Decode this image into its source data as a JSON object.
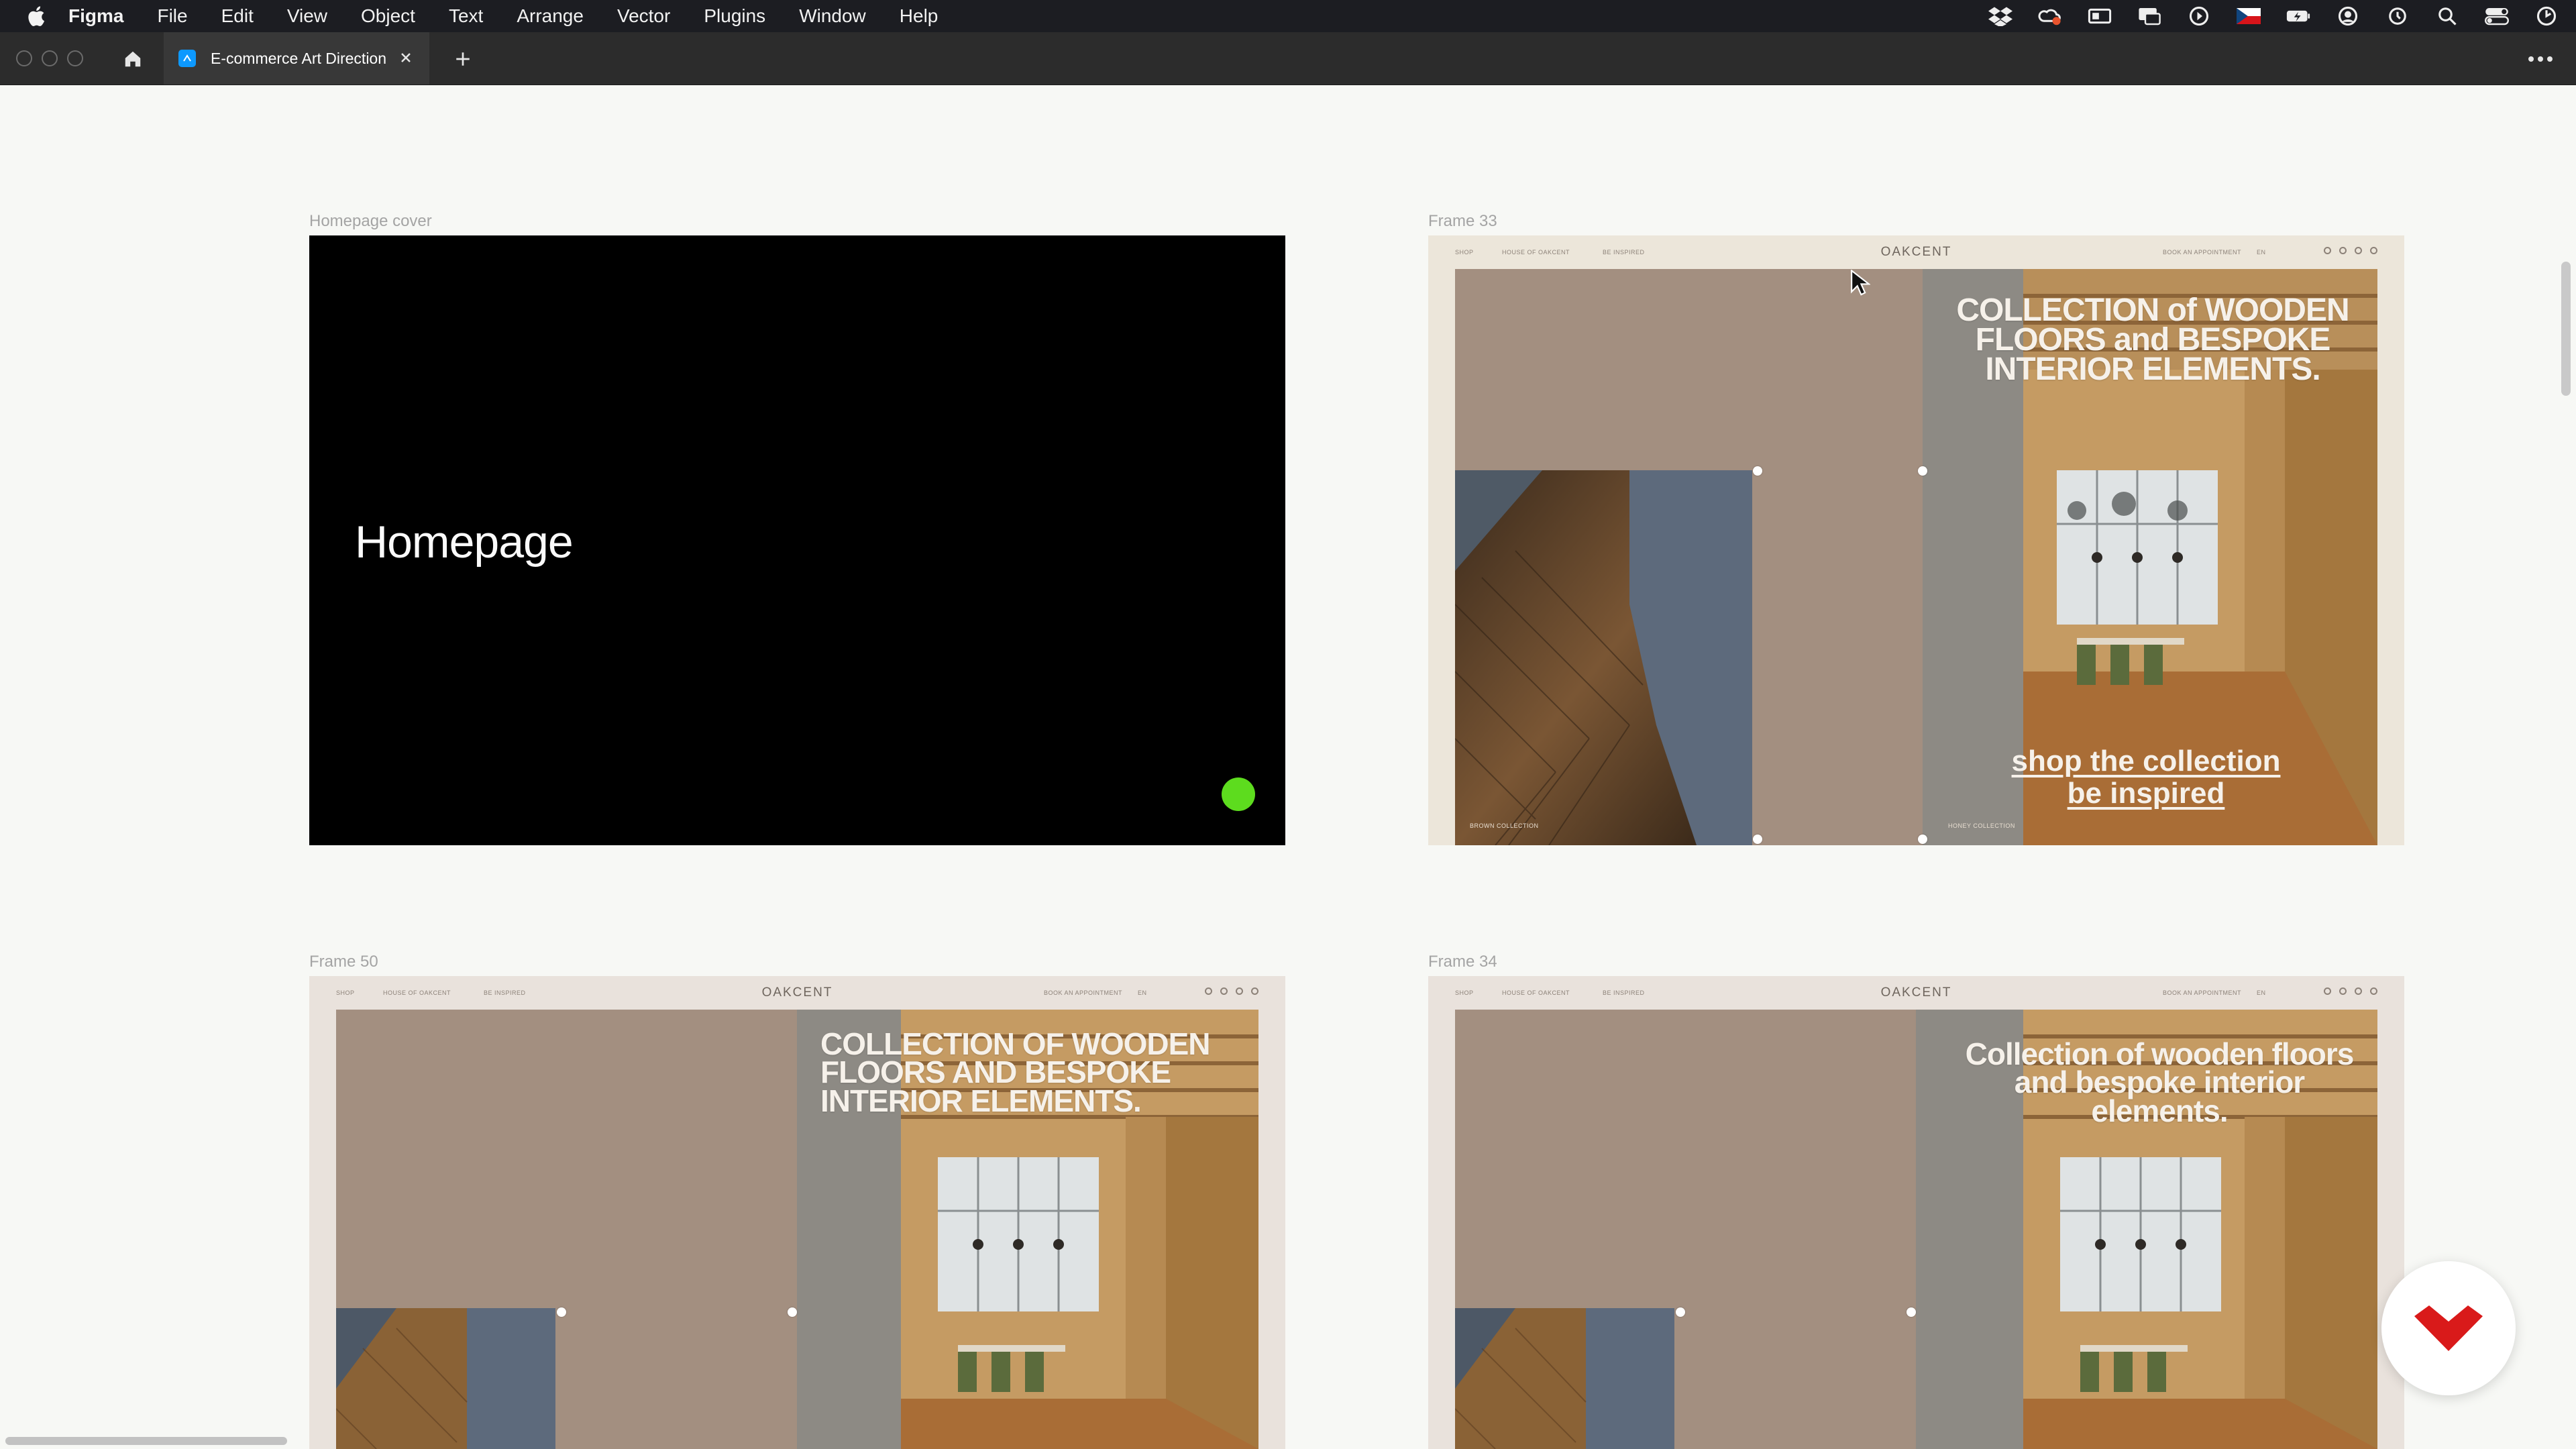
{
  "menubar": {
    "app_name": "Figma",
    "items": [
      "File",
      "Edit",
      "View",
      "Object",
      "Text",
      "Arrange",
      "Vector",
      "Plugins",
      "Window",
      "Help"
    ],
    "status_icons": [
      "dropbox-icon",
      "creative-cloud-icon",
      "screen-icon",
      "display-icon",
      "play-icon",
      "flag-icon",
      "battery-icon",
      "user-icon",
      "time-machine-icon",
      "search-icon",
      "control-center-icon",
      "clock-icon"
    ]
  },
  "tabbar": {
    "tab_title": "E-commerce Art Direction"
  },
  "frames": {
    "cover": {
      "label": "Homepage cover",
      "title": "Homepage"
    },
    "frame33": {
      "label": "Frame 33",
      "nav": {
        "shop": "SHOP",
        "house": "HOUSE OF OAKCENT",
        "inspired": "BE INSPIRED",
        "brand": "OAKCENT",
        "book": "BOOK AN APPOINTMENT",
        "lang": "EN"
      },
      "headline": "COLLECTION of WOODEN FLOORS and BESPOKE INTERIOR ELEMENTS.",
      "cta_shop": "shop the collection",
      "cta_inspired": "be inspired",
      "caption_left": "BROWN COLLECTION",
      "caption_right": "HONEY COLLECTION"
    },
    "frame50": {
      "label": "Frame 50",
      "nav": {
        "shop": "SHOP",
        "house": "HOUSE OF OAKCENT",
        "inspired": "BE INSPIRED",
        "brand": "OAKCENT",
        "book": "BOOK AN APPOINTMENT",
        "lang": "EN"
      },
      "headline": "COLLECTION OF WOODEN FLOORS AND BESPOKE INTERIOR ELEMENTS."
    },
    "frame34": {
      "label": "Frame 34",
      "nav": {
        "shop": "SHOP",
        "house": "HOUSE OF OAKCENT",
        "inspired": "BE INSPIRED",
        "brand": "OAKCENT",
        "book": "BOOK AN APPOINTMENT",
        "lang": "EN"
      },
      "headline": "Collection of wooden floors and bespoke interior elements."
    }
  },
  "colors": {
    "canvas": "#f7f8f5",
    "cover_dot": "#5ddc1e",
    "taupe_panel": "#a38f80",
    "badge_red": "#d91a1a"
  }
}
